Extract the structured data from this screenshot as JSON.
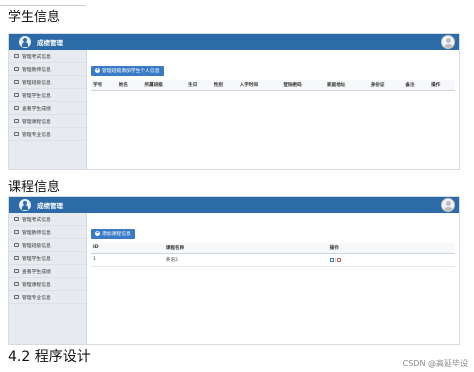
{
  "headings": {
    "student_info": "学生信息",
    "course_info": "课程信息",
    "program_design": "4.2 程序设计"
  },
  "app": {
    "brand_title": "成绩管理"
  },
  "sidebar": {
    "items": [
      {
        "label": "管理考试信息"
      },
      {
        "label": "管理教师信息"
      },
      {
        "label": "管理班级信息"
      },
      {
        "label": "管理学生信息"
      },
      {
        "label": "查看学生成绩"
      },
      {
        "label": "管理课程信息"
      },
      {
        "label": "管理专业信息"
      }
    ]
  },
  "student_panel": {
    "add_button_label": "管理班级添加学生个人信息",
    "columns": [
      "学号",
      "姓名",
      "所属班级",
      "生日",
      "性别",
      "入学时间",
      "登陆密码",
      "家庭地址",
      "身份证",
      "备注",
      "操作"
    ]
  },
  "course_panel": {
    "add_button_label": "添加课程信息",
    "columns": [
      "ID",
      "课程名称",
      "操作"
    ],
    "rows": [
      {
        "id": "1",
        "name": "英语2"
      }
    ]
  },
  "watermark": "CSDN @高延毕设",
  "colors": {
    "topbar": "#2c6aa8",
    "primary_button": "#3a7bc8",
    "sidebar_bg": "#e7eaef",
    "delete": "#d9534f"
  }
}
